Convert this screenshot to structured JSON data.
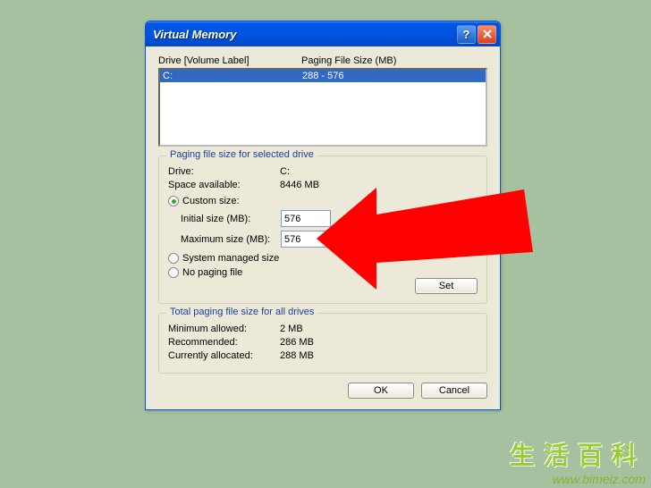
{
  "window": {
    "title": "Virtual Memory"
  },
  "driveList": {
    "header_drive": "Drive  [Volume Label]",
    "header_size": "Paging File Size (MB)",
    "rows": [
      {
        "drive": "C:",
        "size": "288 - 576"
      }
    ]
  },
  "selectedDrive": {
    "legend": "Paging file size for selected drive",
    "drive_label": "Drive:",
    "drive_value": "C:",
    "space_label": "Space available:",
    "space_value": "8446 MB",
    "custom_label": "Custom size:",
    "initial_label": "Initial size (MB):",
    "initial_value": "576",
    "maximum_label": "Maximum size (MB):",
    "maximum_value": "576",
    "system_managed_label": "System managed size",
    "no_paging_label": "No paging file",
    "set_label": "Set"
  },
  "total": {
    "legend": "Total paging file size for all drives",
    "min_label": "Minimum allowed:",
    "min_value": "2 MB",
    "rec_label": "Recommended:",
    "rec_value": "286 MB",
    "cur_label": "Currently allocated:",
    "cur_value": "288 MB"
  },
  "buttons": {
    "ok": "OK",
    "cancel": "Cancel"
  },
  "watermark": {
    "text": "生活百科",
    "url": "www.bimeiz.com"
  }
}
